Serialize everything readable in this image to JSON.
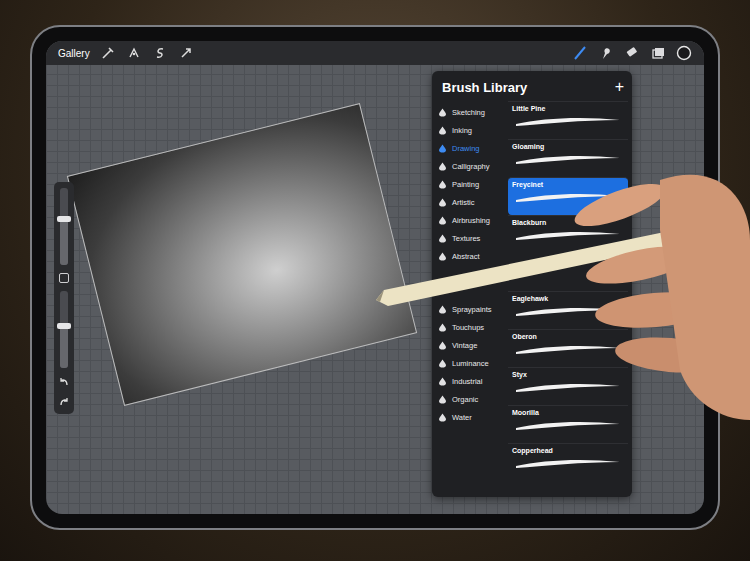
{
  "toolbar": {
    "gallery": "Gallery",
    "tools": [
      {
        "selected": true
      },
      {
        "selected": false
      },
      {
        "selected": false
      },
      {
        "selected": false
      }
    ]
  },
  "sidebar": {
    "size_level": 0.6,
    "opacity_level": 0.55
  },
  "brush_library": {
    "title": "Brush Library",
    "add": "+",
    "categories": [
      {
        "label": "Sketching",
        "selected": false
      },
      {
        "label": "Inking",
        "selected": false
      },
      {
        "label": "Drawing",
        "selected": true
      },
      {
        "label": "Calligraphy",
        "selected": false
      },
      {
        "label": "Painting",
        "selected": false
      },
      {
        "label": "Artistic",
        "selected": false
      },
      {
        "label": "Airbrushing",
        "selected": false
      },
      {
        "label": "Textures",
        "selected": false
      },
      {
        "label": "Abstract",
        "selected": false
      },
      {
        "label": "Spraypaints",
        "selected": false
      },
      {
        "label": "Touchups",
        "selected": false
      },
      {
        "label": "Vintage",
        "selected": false
      },
      {
        "label": "Luminance",
        "selected": false
      },
      {
        "label": "Industrial",
        "selected": false
      },
      {
        "label": "Organic",
        "selected": false
      },
      {
        "label": "Water",
        "selected": false
      }
    ],
    "brushes": [
      {
        "name": "Little Pine",
        "selected": false
      },
      {
        "name": "Gloaming",
        "selected": false
      },
      {
        "name": "Freycinet",
        "selected": true
      },
      {
        "name": "Blackburn",
        "selected": false
      },
      {
        "name": "Eaglehawk",
        "selected": false
      },
      {
        "name": "Oberon",
        "selected": false
      },
      {
        "name": "Styx",
        "selected": false
      },
      {
        "name": "Moorilla",
        "selected": false
      },
      {
        "name": "Copperhead",
        "selected": false
      }
    ]
  }
}
